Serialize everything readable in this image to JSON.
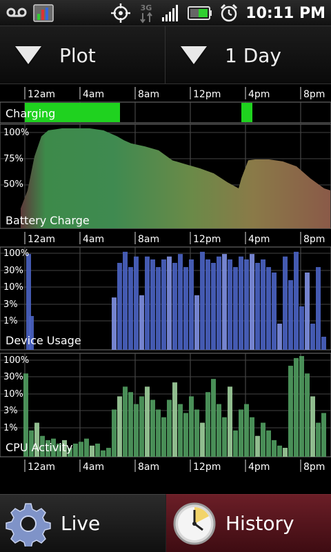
{
  "status_bar": {
    "time": "10:11 PM",
    "icons": [
      "voicemail-icon",
      "app-monitor-icon",
      "gps-icon",
      "3g-data-icon",
      "signal-icon",
      "battery-icon",
      "alarm-icon"
    ],
    "network_label": "3G"
  },
  "toolbar": {
    "mode_label": "Plot",
    "range_label": "1 Day"
  },
  "time_axis": {
    "ticks": [
      "12am",
      "4am",
      "8am",
      "12pm",
      "4pm",
      "8pm"
    ]
  },
  "charts": {
    "charging": {
      "label": "Charging",
      "color": "#1fd21f",
      "segments": [
        [
          0.3,
          7.2
        ],
        [
          16.0,
          16.8
        ]
      ]
    },
    "battery": {
      "label": "Battery Charge",
      "y_ticks": [
        "100%",
        "75%",
        "50%"
      ]
    },
    "usage": {
      "label": "Device Usage",
      "y_ticks": [
        "100%",
        "30%",
        "10%",
        "3%",
        "1%"
      ],
      "color": "#4a62c0"
    },
    "cpu": {
      "label": "CPU Activity",
      "y_ticks": [
        "100%",
        "30%",
        "10%",
        "3%",
        "1%"
      ],
      "color": "#4f9a5e"
    }
  },
  "chart_data": [
    {
      "type": "area",
      "title": "Battery Charge",
      "x_unit": "hour",
      "ylim": [
        0,
        100
      ],
      "x": [
        0,
        0.5,
        1,
        1.5,
        2,
        2.5,
        3,
        4,
        5,
        6,
        7,
        7.5,
        8,
        9,
        10,
        11,
        12,
        13,
        14,
        15,
        15.8,
        16,
        16.5,
        17,
        18,
        19,
        20,
        21,
        22,
        23,
        24
      ],
      "y": [
        20,
        38,
        72,
        92,
        98,
        99,
        100,
        100,
        100,
        98,
        92,
        88,
        85,
        82,
        78,
        68,
        64,
        60,
        55,
        46,
        40,
        50,
        68,
        69,
        69,
        67,
        62,
        50,
        40,
        38,
        36
      ]
    },
    {
      "type": "bar",
      "title": "Device Usage",
      "x_unit": "hour",
      "y_scale": "log",
      "y_ticks_pct": [
        100,
        30,
        10,
        3,
        1
      ],
      "x": [
        0.4,
        0.6,
        6.6,
        7.0,
        7.4,
        7.8,
        8.2,
        8.6,
        9.0,
        9.4,
        9.8,
        10.2,
        10.6,
        11.0,
        11.4,
        11.8,
        12.2,
        12.6,
        13.0,
        13.4,
        13.8,
        14.2,
        14.6,
        15.0,
        15.4,
        15.8,
        16.2,
        16.6,
        17.0,
        17.4,
        17.8,
        18.2,
        18.6,
        19.0,
        19.4,
        19.8,
        20.2,
        20.6,
        21.0,
        21.4,
        21.8
      ],
      "values": [
        80,
        3,
        8,
        50,
        90,
        40,
        70,
        9,
        70,
        60,
        40,
        60,
        70,
        50,
        80,
        40,
        60,
        9,
        90,
        60,
        50,
        70,
        80,
        60,
        40,
        70,
        60,
        80,
        50,
        60,
        40,
        30,
        2,
        70,
        20,
        90,
        5,
        30,
        2,
        40,
        1
      ]
    },
    {
      "type": "bar",
      "title": "CPU Activity",
      "x_unit": "hour",
      "y_scale": "log",
      "y_ticks_pct": [
        100,
        30,
        10,
        3,
        1
      ],
      "x": [
        0.2,
        0.6,
        1.0,
        1.4,
        1.8,
        2.2,
        2.6,
        3.0,
        3.4,
        3.8,
        4.2,
        4.6,
        5.0,
        5.4,
        5.8,
        6.2,
        6.6,
        7.0,
        7.4,
        7.8,
        8.2,
        8.6,
        9.0,
        9.4,
        9.8,
        10.2,
        10.6,
        11.0,
        11.4,
        11.8,
        12.2,
        12.6,
        13.0,
        13.4,
        13.8,
        14.2,
        14.6,
        15.0,
        15.4,
        15.8,
        16.2,
        16.6,
        17.0,
        17.4,
        17.8,
        18.2,
        18.6,
        19.0,
        19.4,
        19.8,
        20.2,
        20.6,
        21.0,
        21.4,
        21.8
      ],
      "values": [
        40,
        2,
        3,
        1.5,
        1.2,
        1.3,
        1,
        1.2,
        0.8,
        1,
        1.1,
        1.3,
        0.9,
        1,
        0.7,
        0.8,
        6,
        12,
        20,
        15,
        8,
        12,
        20,
        10,
        6,
        4,
        10,
        25,
        8,
        5,
        12,
        6,
        3,
        15,
        30,
        8,
        4,
        20,
        2,
        6,
        8,
        4,
        1.5,
        3,
        2,
        1.2,
        0.9,
        0.8,
        60,
        90,
        100,
        40,
        12,
        3,
        5
      ]
    }
  ],
  "bottom_nav": {
    "live_label": "Live",
    "history_label": "History"
  }
}
